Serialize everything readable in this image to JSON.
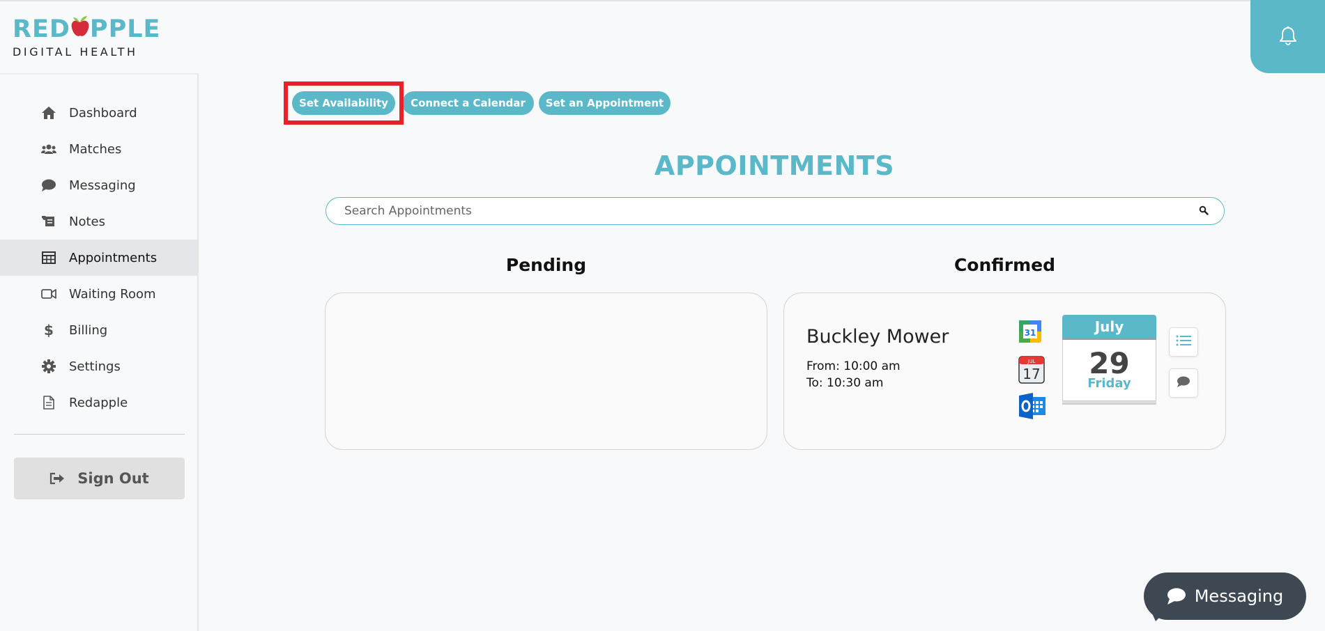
{
  "brand": {
    "logo_part1": "RED",
    "logo_part2": "PPLE",
    "logo_sub": "DIGITAL HEALTH",
    "accent": "#5bb8c9",
    "apple_red": "#d62b3a",
    "leaf_green": "#8cc63f"
  },
  "header": {
    "bell_icon": "bell-icon"
  },
  "sidebar": {
    "items": [
      {
        "label": "Dashboard",
        "icon": "home-icon"
      },
      {
        "label": "Matches",
        "icon": "users-icon"
      },
      {
        "label": "Messaging",
        "icon": "chat-bubble-icon"
      },
      {
        "label": "Notes",
        "icon": "scroll-icon"
      },
      {
        "label": "Appointments",
        "icon": "table-icon",
        "active": true
      },
      {
        "label": "Waiting Room",
        "icon": "video-camera-icon"
      },
      {
        "label": "Billing",
        "icon": "dollar-icon"
      },
      {
        "label": "Settings",
        "icon": "gear-icon"
      },
      {
        "label": "Redapple",
        "icon": "document-icon"
      }
    ],
    "signout_label": "Sign Out"
  },
  "toolbar": {
    "set_availability": "Set Availability",
    "connect_calendar": "Connect a Calendar",
    "set_appointment": "Set an Appointment"
  },
  "main": {
    "title": "APPOINTMENTS",
    "search_placeholder": "Search Appointments",
    "pending_label": "Pending",
    "confirmed_label": "Confirmed",
    "confirmed_items": [
      {
        "name": "Buckley Mower",
        "from": "From: 10:00 am",
        "to": "To: 10:30 am",
        "month": "July",
        "day": "29",
        "weekday": "Friday",
        "gcal_day": "31",
        "ical_month": "JUL",
        "ical_day": "17"
      }
    ]
  },
  "chat_widget": {
    "label": "Messaging"
  }
}
